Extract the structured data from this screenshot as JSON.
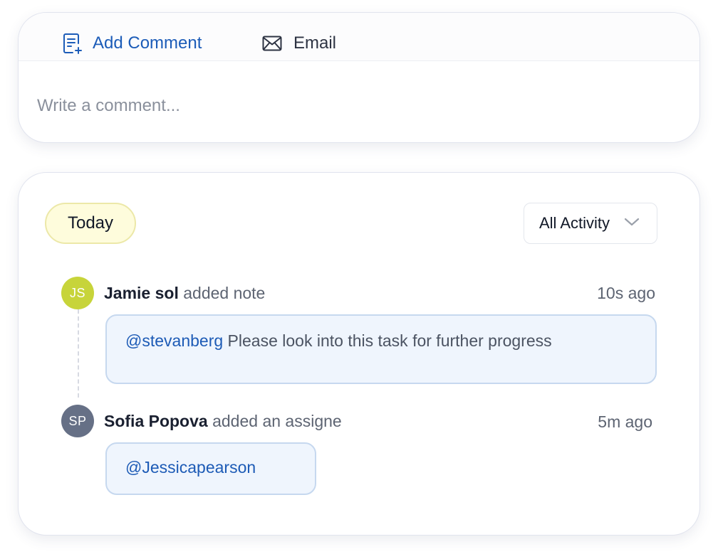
{
  "composer": {
    "tabs": [
      {
        "label": "Add Comment",
        "icon": "add-note-icon",
        "active": true
      },
      {
        "label": "Email",
        "icon": "mail-icon",
        "active": false
      }
    ],
    "input": {
      "placeholder": "Write a comment...",
      "value": ""
    }
  },
  "activity": {
    "group_label": "Today",
    "filter": {
      "selected": "All Activity",
      "icon": "chevron-down-icon"
    },
    "entries": [
      {
        "avatar_initials": "JS",
        "avatar_color": "#c7d43a",
        "actor": "Jamie sol",
        "action": "added note",
        "time": "10s ago",
        "mention": "@stevanberg",
        "message": "Please look into this task for further progress"
      },
      {
        "avatar_initials": "SP",
        "avatar_color": "#667086",
        "actor": "Sofia Popova",
        "action": "added an assigne",
        "time": "5m ago",
        "mention": "@Jessicapearson",
        "message": ""
      }
    ]
  },
  "colors": {
    "accent": "#1c5cb8",
    "badge_bg": "#fefcdc",
    "bubble_bg": "#eff5fd",
    "bubble_border": "#c6d8ef"
  }
}
